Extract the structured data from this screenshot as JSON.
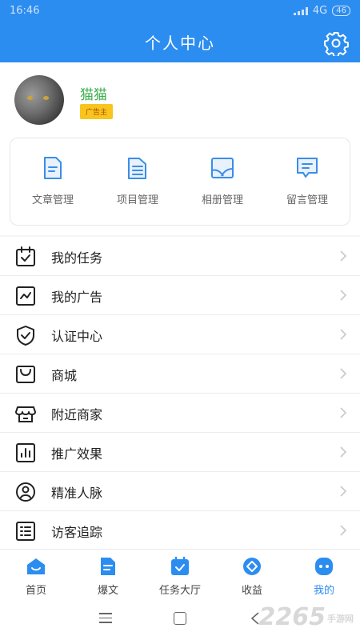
{
  "status_bar": {
    "time": "16:46",
    "network": "4G",
    "battery": "46"
  },
  "header": {
    "title": "个人中心",
    "settings_icon": "gear-icon"
  },
  "profile": {
    "name": "猫猫",
    "badge": "广告主"
  },
  "manage": [
    {
      "label": "文章管理",
      "icon": "article-icon"
    },
    {
      "label": "项目管理",
      "icon": "project-icon"
    },
    {
      "label": "相册管理",
      "icon": "album-icon"
    },
    {
      "label": "留言管理",
      "icon": "message-icon"
    }
  ],
  "menu": [
    {
      "label": "我的任务",
      "icon": "calendar-check-icon"
    },
    {
      "label": "我的广告",
      "icon": "trend-icon"
    },
    {
      "label": "认证中心",
      "icon": "shield-check-icon"
    },
    {
      "label": "商城",
      "icon": "bag-icon"
    },
    {
      "label": "附近商家",
      "icon": "store-icon"
    },
    {
      "label": "推广效果",
      "icon": "bar-chart-icon"
    },
    {
      "label": "精准人脉",
      "icon": "person-icon"
    },
    {
      "label": "访客追踪",
      "icon": "list-icon"
    }
  ],
  "tabs": [
    {
      "label": "首页",
      "icon": "home-icon",
      "active": false
    },
    {
      "label": "爆文",
      "icon": "doc-icon",
      "active": false
    },
    {
      "label": "任务大厅",
      "icon": "task-icon",
      "active": false
    },
    {
      "label": "收益",
      "icon": "earnings-icon",
      "active": false
    },
    {
      "label": "我的",
      "icon": "profile-tab-icon",
      "active": true
    }
  ],
  "watermark": {
    "text": "2265",
    "suffix": "手游网"
  },
  "colors": {
    "primary": "#2c8df0",
    "name_green": "#3cae4a",
    "badge_yellow": "#f7c51d"
  }
}
